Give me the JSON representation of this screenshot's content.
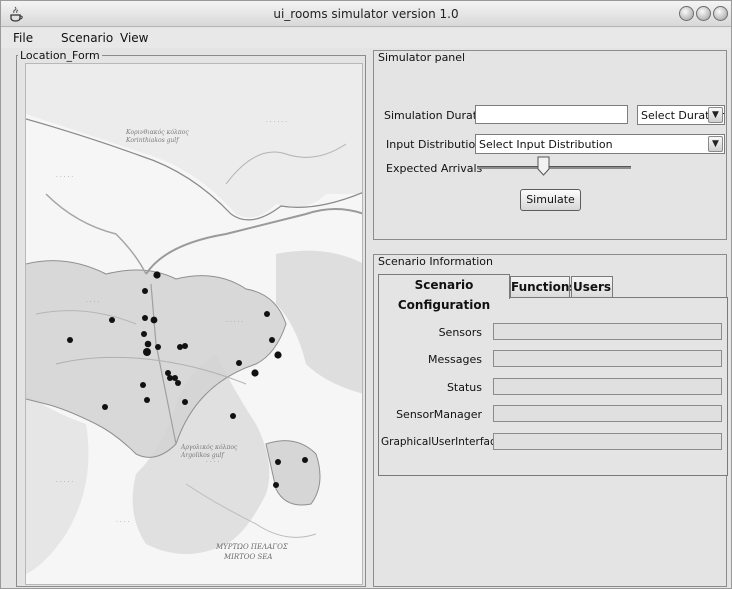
{
  "window": {
    "title": "ui_rooms simulator version 1.0",
    "icon": "java-cup-icon"
  },
  "menubar": [
    "File",
    "Scenario",
    "View"
  ],
  "location_form": {
    "legend": "Location_Form",
    "map_labels": {
      "gulf_top": [
        "Κορινθιακός κόλπος",
        "Korinthiakos gulf"
      ],
      "gulf_mid": [
        "Αργολικός κόλπος",
        "Argolikos gulf"
      ],
      "sea": [
        "ΜΥΡΤΩΟ ΠΕΛΑΓΟΣ",
        "MIRTOO SEA"
      ]
    }
  },
  "simulator_panel": {
    "legend": "Simulator panel",
    "duration_label": "Simulation Duration",
    "duration_value": "",
    "duration_select": "Select Duration",
    "distribution_label": "Input Distribution",
    "distribution_select": "Select Input Distribution",
    "arrivals_label": "Expected Arrivals",
    "arrivals_level": 0.43,
    "simulate_button": "Simulate"
  },
  "scenario_info": {
    "legend": "Scenario Information",
    "tabs": [
      "Scenario Configuration",
      "Functions",
      "Users"
    ],
    "active_tab": "Scenario Configuration",
    "fields": [
      {
        "label": "Sensors",
        "value": ""
      },
      {
        "label": "Messages",
        "value": ""
      },
      {
        "label": "Status",
        "value": ""
      },
      {
        "label": "SensorManager",
        "value": ""
      },
      {
        "label": "GraphicalUserInterface",
        "value": ""
      }
    ]
  },
  "colors": {
    "window_bg": "#e4e4e4",
    "marker": "#111111"
  }
}
